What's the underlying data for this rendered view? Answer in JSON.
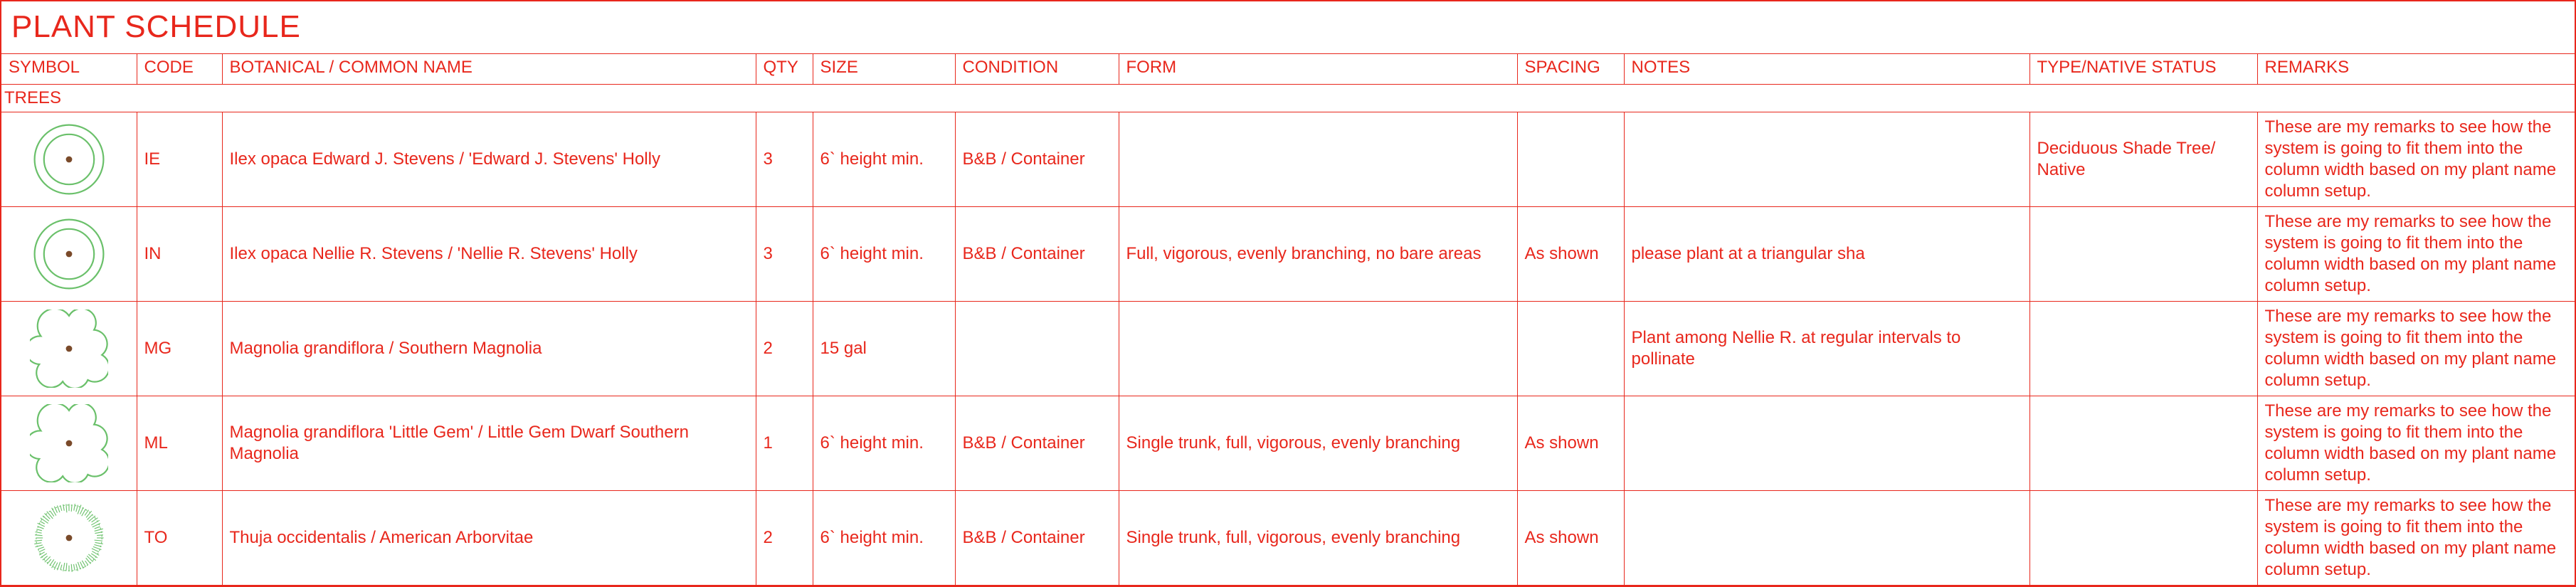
{
  "title": "PLANT SCHEDULE",
  "headers": {
    "symbol": "SYMBOL",
    "code": "CODE",
    "name": "BOTANICAL / COMMON NAME",
    "qty": "QTY",
    "size": "SIZE",
    "condition": "CONDITION",
    "form": "FORM",
    "spacing": "SPACING",
    "notes": "NOTES",
    "type": "TYPE/NATIVE STATUS",
    "remarks": "REMARKS"
  },
  "section": "TREES",
  "rows": [
    {
      "code": "IE",
      "name": "Ilex opaca Edward J. Stevens / 'Edward J. Stevens' Holly",
      "qty": "3",
      "size": "6` height min.",
      "condition": "B&B / Container",
      "form": "",
      "spacing": "",
      "notes": "",
      "type": "Deciduous Shade Tree/ Native",
      "remarks": "These are my remarks to see how the system is going to fit them into the column width based on my plant name column setup.",
      "symbol_kind": "concentric"
    },
    {
      "code": "IN",
      "name": "Ilex opaca Nellie R. Stevens / 'Nellie R. Stevens' Holly",
      "qty": "3",
      "size": "6` height min.",
      "condition": "B&B / Container",
      "form": "Full, vigorous, evenly branching, no bare areas",
      "spacing": "As shown",
      "notes": "please plant at a triangular sha",
      "type": "",
      "remarks": "These are my remarks to see how the system is going to fit them into the column width based on my plant name column setup.",
      "symbol_kind": "concentric"
    },
    {
      "code": "MG",
      "name": "Magnolia grandiflora / Southern Magnolia",
      "qty": "2",
      "size": "15 gal",
      "condition": "",
      "form": "",
      "spacing": "",
      "notes": "Plant among Nellie R. at regular intervals to pollinate",
      "type": "",
      "remarks": "These are my remarks to see how the system is going to fit them into the column width based on my plant name column setup.",
      "symbol_kind": "cloud"
    },
    {
      "code": "ML",
      "name": "Magnolia grandiflora 'Little Gem' / Little Gem Dwarf Southern Magnolia",
      "qty": "1",
      "size": "6` height min.",
      "condition": "B&B / Container",
      "form": "Single trunk, full, vigorous, evenly branching",
      "spacing": "As shown",
      "notes": "",
      "type": "",
      "remarks": "These are my remarks to see how the system is going to fit them into the column width based on my plant name column setup.",
      "symbol_kind": "cloud"
    },
    {
      "code": "TO",
      "name": "Thuja occidentalis / American Arborvitae",
      "qty": "2",
      "size": "6` height min.",
      "condition": "B&B / Container",
      "form": "Single trunk, full, vigorous, evenly branching",
      "spacing": "As shown",
      "notes": "",
      "type": "",
      "remarks": "These are my remarks to see how the system is going to fit them into the column width based on my plant name column setup.",
      "symbol_kind": "feather"
    }
  ],
  "colors": {
    "green": "#6ac06a",
    "brown": "#7a4a2a"
  }
}
